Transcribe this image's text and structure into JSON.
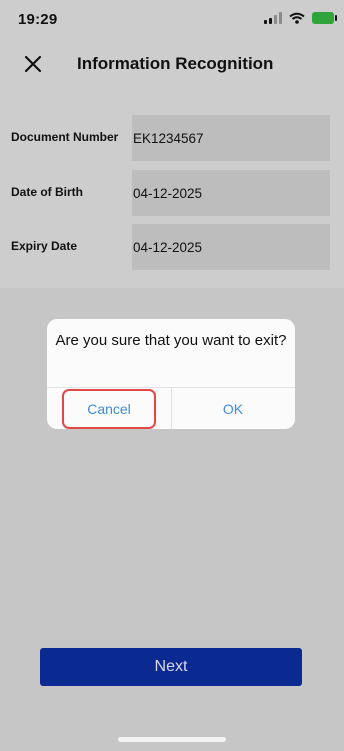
{
  "status_bar": {
    "time": "19:29",
    "icons": [
      "signal-icon",
      "wifi-icon",
      "battery-icon"
    ],
    "battery_color": "#2fa43b"
  },
  "header": {
    "close_icon": "close-icon",
    "title": "Information Recognition"
  },
  "fields": [
    {
      "label": "Document Number",
      "value": "EK1234567"
    },
    {
      "label": "Date of Birth",
      "value": "04-12-2025"
    },
    {
      "label": "Expiry Date",
      "value": "04-12-2025"
    }
  ],
  "dialog": {
    "message": "Are you sure that you want to exit?",
    "cancel_label": "Cancel",
    "ok_label": "OK",
    "button_color": "#3e8cd6"
  },
  "footer": {
    "next_label": "Next",
    "next_color": "#0a2a92"
  },
  "annotation": {
    "highlight_color": "#e04848"
  }
}
